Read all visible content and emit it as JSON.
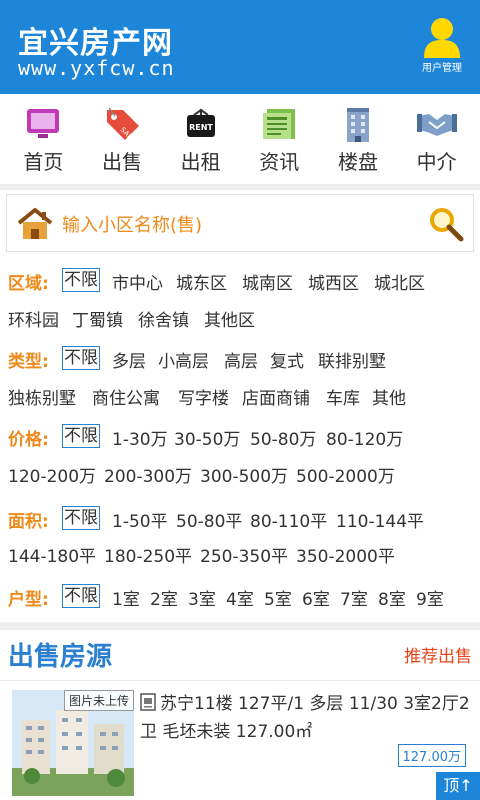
{
  "header": {
    "title": "宜兴房产网",
    "url": "www.yxfcw.cn",
    "user_mgmt_label": "用户管理"
  },
  "nav": [
    {
      "label": "首页",
      "icon": "monitor-icon"
    },
    {
      "label": "出售",
      "icon": "sale-tag-icon"
    },
    {
      "label": "出租",
      "icon": "rent-sign-icon"
    },
    {
      "label": "资讯",
      "icon": "newspaper-icon"
    },
    {
      "label": "楼盘",
      "icon": "building-icon"
    },
    {
      "label": "中介",
      "icon": "handshake-icon"
    }
  ],
  "search": {
    "placeholder": "输入小区名称(售)"
  },
  "filters": {
    "region": {
      "label": "区域:",
      "options": [
        "不限",
        "市中心",
        "城东区",
        "城南区",
        "城西区",
        "城北区",
        "环科园",
        "丁蜀镇",
        "徐舍镇",
        "其他区"
      ]
    },
    "type": {
      "label": "类型:",
      "options": [
        "不限",
        "多层",
        "小高层",
        "高层",
        "复式",
        "联排别墅",
        "独栋别墅",
        "商住公寓",
        "写字楼",
        "店面商铺",
        "车库",
        "其他"
      ]
    },
    "price": {
      "label": "价格:",
      "options": [
        "不限",
        "1-30万",
        "30-50万",
        "50-80万",
        "80-120万",
        "120-200万",
        "200-300万",
        "300-500万",
        "500-2000万"
      ]
    },
    "area": {
      "label": "面积:",
      "options": [
        "不限",
        "1-50平",
        "50-80平",
        "80-110平",
        "110-144平",
        "144-180平",
        "180-250平",
        "250-350平",
        "350-2000平"
      ]
    },
    "layout": {
      "label": "户型:",
      "options": [
        "不限",
        "1室",
        "2室",
        "3室",
        "4室",
        "5室",
        "6室",
        "7室",
        "8室",
        "9室"
      ]
    }
  },
  "listings_section": {
    "title": "出售房源",
    "link": "推荐出售",
    "items": [
      {
        "thumb_tag": "图片未上传",
        "title": "苏宁11楼 127平/1 多层 11/30 3室2厅2卫 毛坯未装 127.00㎡",
        "price": "127.00万"
      }
    ]
  },
  "top_button": "顶↑",
  "colors": {
    "header_bg": "#1e86d8",
    "accent_orange": "#ef8a1a",
    "accent_blue": "#2a7fd0",
    "link_red": "#e8451b"
  }
}
